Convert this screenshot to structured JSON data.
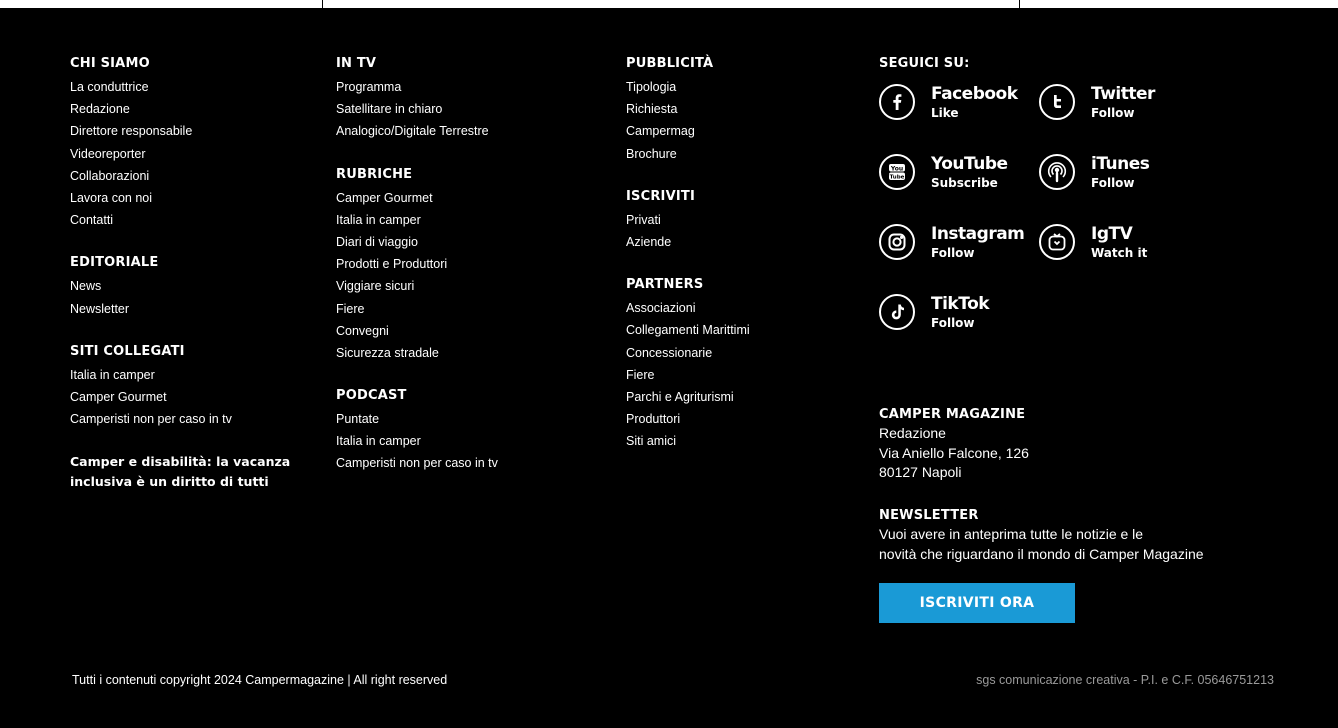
{
  "chi_siamo": {
    "title": "CHI SIAMO",
    "items": [
      "La conduttrice",
      "Redazione",
      "Direttore responsabile",
      "Videoreporter",
      "Collaborazioni",
      "Lavora con noi",
      "Contatti"
    ]
  },
  "editoriale": {
    "title": "EDITORIALE",
    "items": [
      "News",
      "Newsletter"
    ]
  },
  "siti_collegati": {
    "title": "SITI COLLEGATI",
    "items": [
      "Italia in camper",
      "Camper Gourmet",
      "Camperisti non per caso in tv"
    ]
  },
  "feature_link": {
    "line1": "Camper e disabilità: la vacanza",
    "line2": "inclusiva è un diritto di tutti"
  },
  "in_tv": {
    "title": "IN TV",
    "items": [
      "Programma",
      "Satellitare in chiaro",
      "Analogico/Digitale Terrestre"
    ]
  },
  "rubriche": {
    "title": "RUBRICHE",
    "items": [
      "Camper Gourmet",
      "Italia in camper",
      "Diari di viaggio",
      "Prodotti e Produttori",
      "Viggiare sicuri",
      "Fiere",
      "Convegni",
      "Sicurezza stradale"
    ]
  },
  "podcast": {
    "title": "PODCAST",
    "items": [
      "Puntate",
      "Italia in camper",
      "Camperisti non per caso in tv"
    ]
  },
  "pubblicita": {
    "title": "PUBBLICITÀ",
    "items": [
      "Tipologia",
      "Richiesta",
      "Campermag",
      "Brochure"
    ]
  },
  "iscriviti": {
    "title": "ISCRIVITI",
    "items": [
      "Privati",
      "Aziende"
    ]
  },
  "partners": {
    "title": "PARTNERS",
    "items": [
      "Associazioni",
      "Collegamenti Marittimi",
      "Concessionarie",
      "Fiere",
      "Parchi e Agriturismi",
      "Produttori",
      "Siti amici"
    ]
  },
  "social": {
    "title": "SEGUICI SU:",
    "buttons": [
      {
        "name": "Facebook",
        "action": "Like",
        "icon": "facebook-icon"
      },
      {
        "name": "Twitter",
        "action": "Follow",
        "icon": "twitter-icon"
      },
      {
        "name": "YouTube",
        "action": "Subscribe",
        "icon": "youtube-icon"
      },
      {
        "name": "iTunes",
        "action": "Follow",
        "icon": "itunes-icon"
      },
      {
        "name": "Instagram",
        "action": "Follow",
        "icon": "instagram-icon"
      },
      {
        "name": "IgTV",
        "action": "Watch it",
        "icon": "igtv-icon"
      },
      {
        "name": "TikTok",
        "action": "Follow",
        "icon": "tiktok-icon"
      }
    ]
  },
  "contact": {
    "title": "CAMPER MAGAZINE",
    "line1": "Redazione",
    "line2": "Via Aniello Falcone, 126",
    "line3": "80127 Napoli"
  },
  "newsletter": {
    "title": "NEWSLETTER",
    "line1": "Vuoi avere in anteprima tutte le notizie e le",
    "line2": "novità che riguardano il mondo di Camper Magazine",
    "button": "ISCRIVITI ORA"
  },
  "footer": {
    "copyright": "Tutti i contenuti copyright 2024 Campermagazine | All right reserved",
    "credits": "sgs comunicazione creativa - P.I. e C.F. 05646751213"
  },
  "colors": {
    "background": "#000000",
    "text": "#ffffff",
    "accent": "#1a9ad6",
    "muted": "#9a9a9a"
  }
}
